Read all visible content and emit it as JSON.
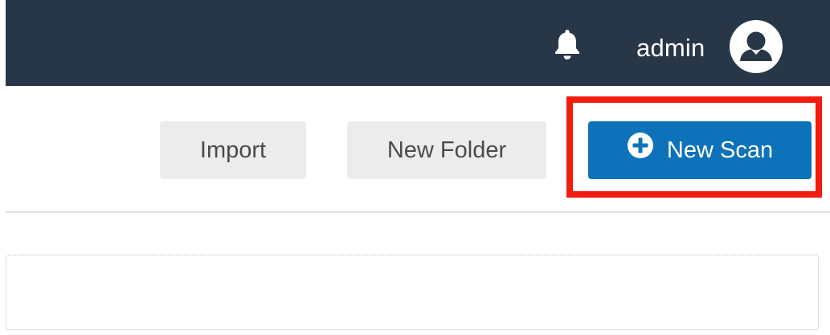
{
  "header": {
    "notifications_icon": "bell-icon",
    "user_name": "admin",
    "avatar_icon": "user-avatar-icon"
  },
  "toolbar": {
    "import_label": "Import",
    "new_folder_label": "New Folder",
    "new_scan_label": "New Scan",
    "new_scan_icon": "plus-circle-icon"
  },
  "colors": {
    "header_bg": "#273747",
    "primary_button": "#0d72b9",
    "secondary_button": "#ececec",
    "highlight": "#f21c0f"
  }
}
